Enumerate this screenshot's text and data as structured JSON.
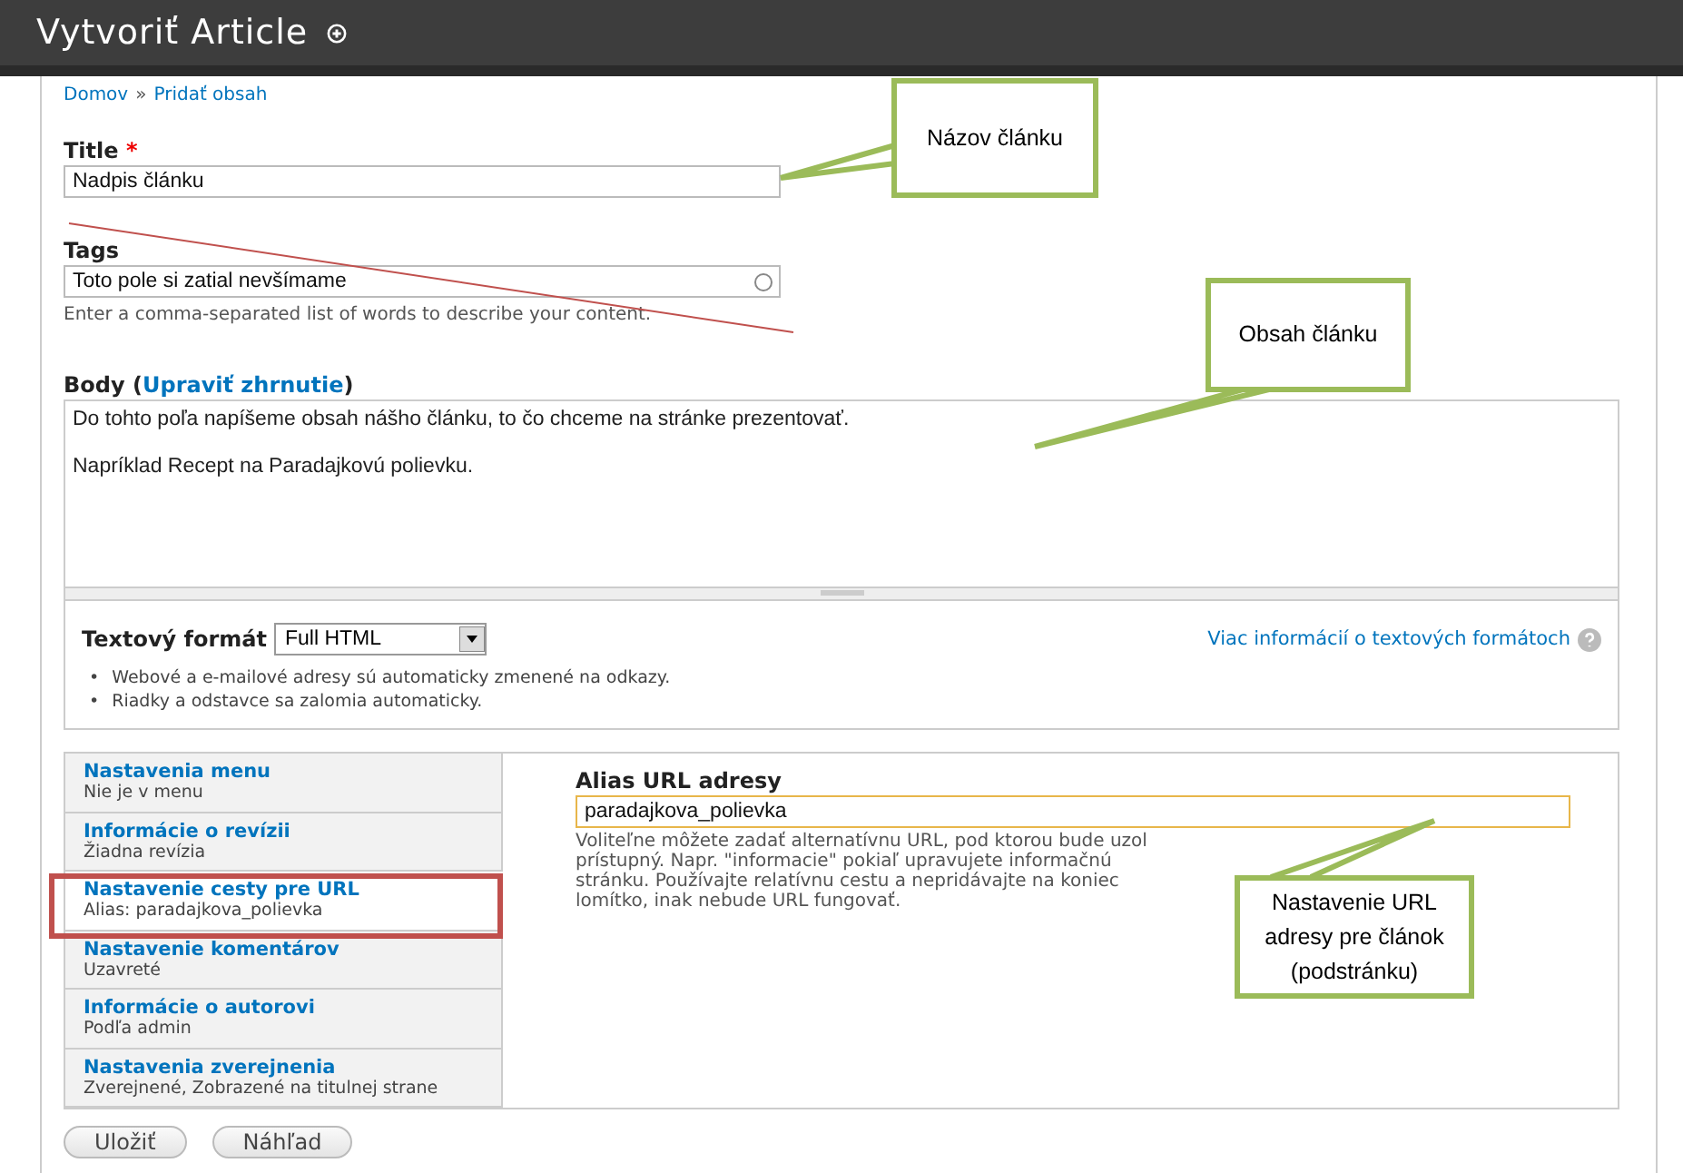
{
  "header": {
    "title": "Vytvoriť Article"
  },
  "breadcrumb": {
    "items": [
      "Domov",
      "Pridať obsah"
    ],
    "separator": "»"
  },
  "title_field": {
    "label": "Title",
    "required_mark": "*",
    "value": "Nadpis článku"
  },
  "tags_field": {
    "label": "Tags",
    "value": "Toto pole si zatial nevšímame",
    "description": "Enter a comma-separated list of words to describe your content."
  },
  "body_field": {
    "label": "Body",
    "paren_open": "(",
    "summary_link": "Upraviť zhrnutie",
    "paren_close": ")",
    "paragraphs": [
      "Do tohto poľa napíšeme obsah nášho článku, to čo chceme na stránke prezentovať.",
      "Napríklad Recept na Paradajkovú polievku."
    ],
    "text_format": {
      "label": "Textový formát",
      "value": "Full HTML",
      "help_link": "Viac informácií o textových formátoch",
      "tip_bullet": "•",
      "tips": [
        "Webové a e-mailové adresy sú automaticky zmenené na odkazy.",
        "Riadky a odstavce sa zalomia automaticky."
      ]
    }
  },
  "vertical_tabs": [
    {
      "title": "Nastavenia menu",
      "summary": "Nie je v menu",
      "selected": false
    },
    {
      "title": "Informácie o revízii",
      "summary": "Žiadna revízia",
      "selected": false
    },
    {
      "title": "Nastavenie cesty pre URL",
      "summary": "Alias: paradajkova_polievka",
      "selected": true
    },
    {
      "title": "Nastavenie komentárov",
      "summary": "Uzavreté",
      "selected": false
    },
    {
      "title": "Informácie o autorovi",
      "summary": "Podľa admin",
      "selected": false
    },
    {
      "title": "Nastavenia zverejnenia",
      "summary": "Zverejnené, Zobrazené na titulnej strane",
      "selected": false
    }
  ],
  "alias_panel": {
    "label": "Alias URL adresy",
    "value": "paradajkova_polievka",
    "description": "Voliteľne môžete zadať alternatívnu URL, pod ktorou bude uzol prístupný. Napr. \"informacie\" pokiaľ upravujete informačnú stránku. Používajte relatívnu cestu a nepridávajte na koniec lomítko, inak nebude URL fungovať."
  },
  "buttons": [
    "Uložiť",
    "Náhľad"
  ],
  "callouts": [
    "Názov článku",
    "Obsah článku",
    "Nastavenie URL adresy pre článok (podstránku)"
  ]
}
